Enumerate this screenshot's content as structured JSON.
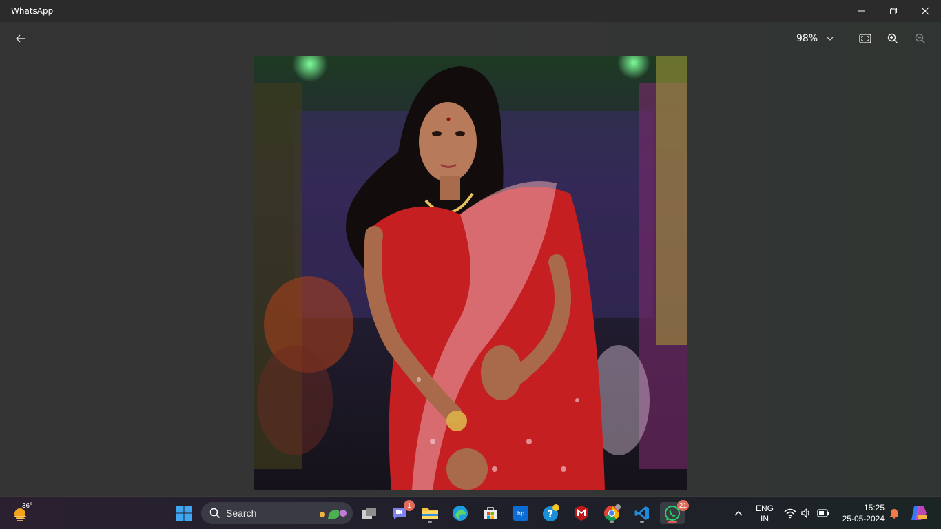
{
  "window": {
    "title": "WhatsApp",
    "controls": [
      "minimize",
      "restore",
      "close"
    ]
  },
  "viewer": {
    "zoom_level": "98%"
  },
  "taskbar": {
    "weather_temp": "36°",
    "search_placeholder": "Search",
    "apps": [
      {
        "name": "teams",
        "badge": "1"
      },
      {
        "name": "whatsapp",
        "badge": "21"
      }
    ],
    "language": "ENG",
    "region": "IN",
    "time": "15:25",
    "date": "25-05-2024"
  }
}
